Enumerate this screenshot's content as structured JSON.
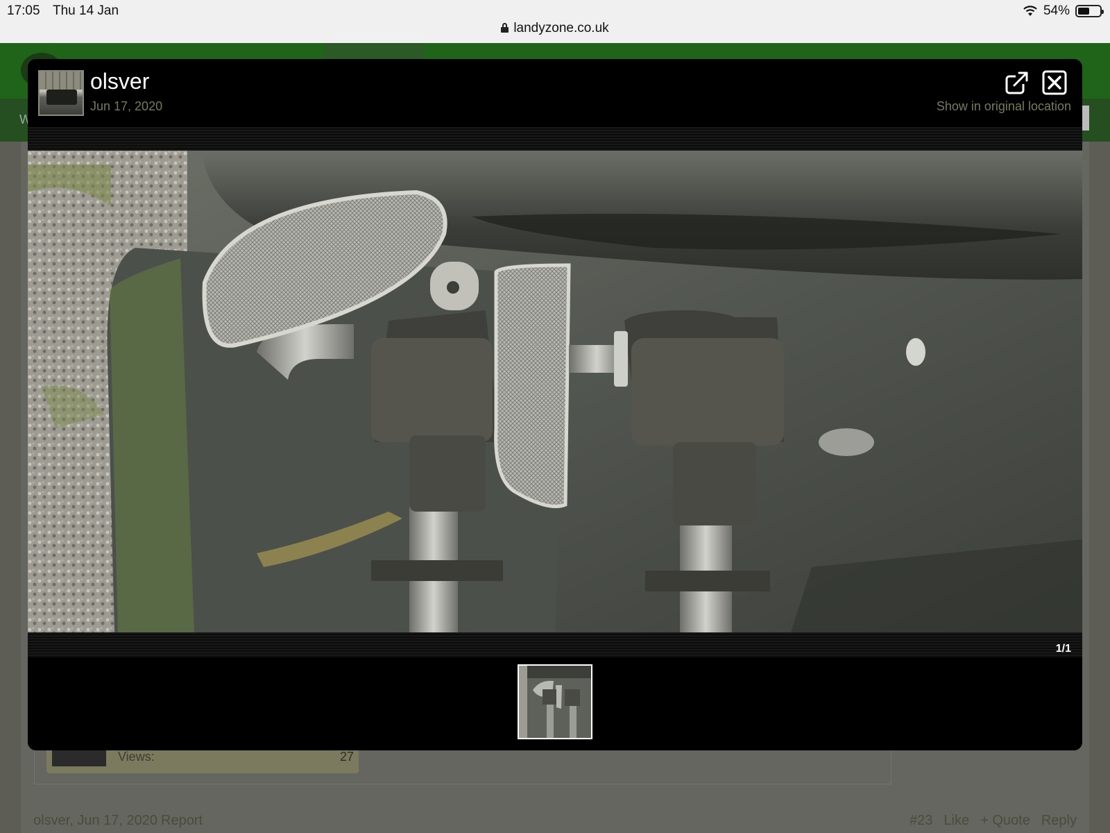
{
  "status_bar": {
    "time": "17:05",
    "date": "Thu 14 Jan",
    "battery": "54%",
    "battery_level": 0.54
  },
  "browser": {
    "url": "landyzone.co.uk"
  },
  "background_page": {
    "nav_letter": "W",
    "views_label": "Views:",
    "views_value": "27",
    "post_meta": "olsver, Jun 17, 2020",
    "report_label": "Report",
    "post_number": "#23",
    "like_label": "Like",
    "quote_label": "+ Quote",
    "reply_label": "Reply"
  },
  "lightbox": {
    "username": "olsver",
    "date": "Jun 17, 2020",
    "show_original": "Show in original location",
    "counter": "1/1",
    "icons": {
      "open": "external-link-icon",
      "close": "close-icon"
    }
  }
}
